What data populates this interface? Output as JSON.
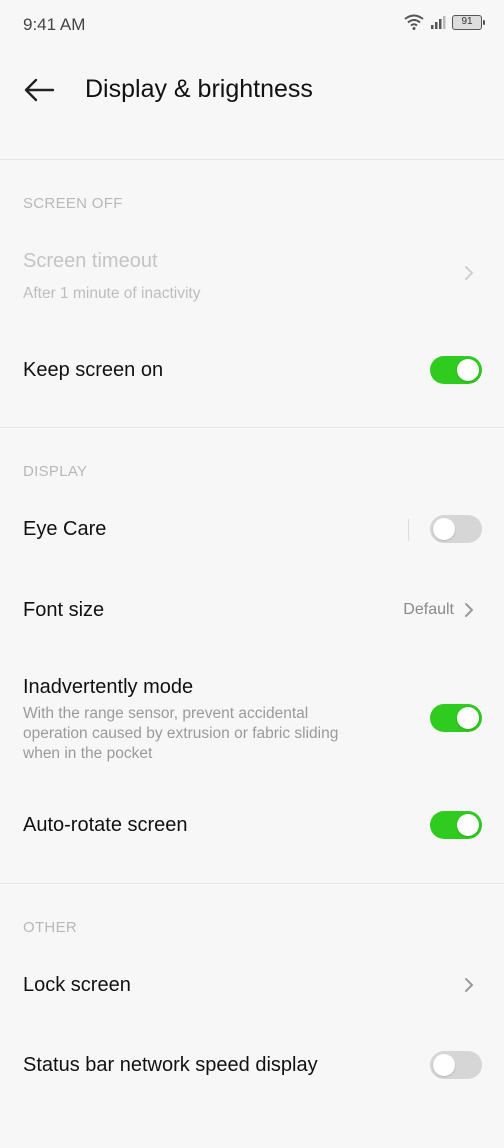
{
  "status_bar": {
    "time": "9:41 AM",
    "battery": "91"
  },
  "header": {
    "title": "Display & brightness"
  },
  "sections": {
    "screen_off": {
      "title": "SCREEN OFF",
      "screen_timeout": {
        "label": "Screen timeout",
        "sub": "After 1 minute of inactivity",
        "enabled": false
      },
      "keep_screen_on": {
        "label": "Keep screen on",
        "toggle": true
      }
    },
    "display": {
      "title": "DISPLAY",
      "eye_care": {
        "label": "Eye Care",
        "toggle": false
      },
      "font_size": {
        "label": "Font size",
        "value": "Default"
      },
      "inadvertently_mode": {
        "label": "Inadvertently mode",
        "sub_line1": "With the range sensor, prevent accidental",
        "sub_line2": "operation caused by extrusion or fabric sliding",
        "sub_line3": "when in the pocket",
        "toggle": true
      },
      "auto_rotate": {
        "label": "Auto-rotate screen",
        "toggle": true
      }
    },
    "other": {
      "title": "OTHER",
      "lock_screen": {
        "label": "Lock screen"
      },
      "network_speed": {
        "label": "Status bar network speed display",
        "toggle": false
      }
    }
  },
  "colors": {
    "toggle_on": "#2fcb1e",
    "toggle_off": "#d6d6d6",
    "background": "#f7f7f7"
  }
}
